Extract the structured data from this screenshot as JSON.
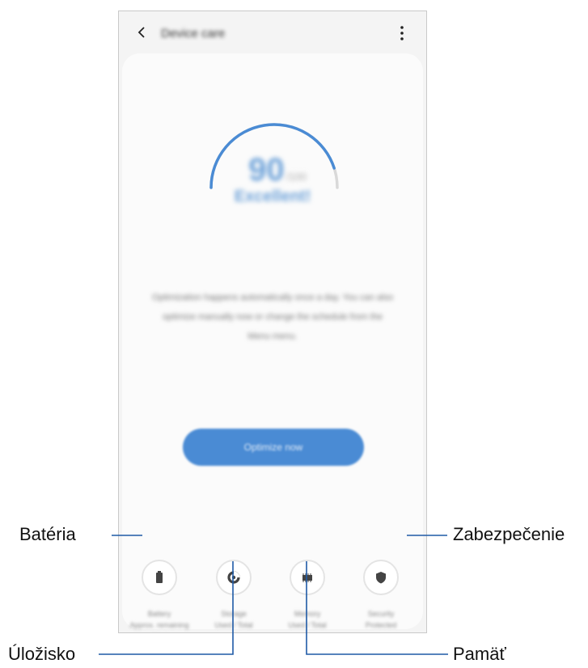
{
  "app_bar": {
    "title": "Device care",
    "back_icon": "chevron-left-icon",
    "menu_icon": "more-vertical-icon"
  },
  "score": {
    "value": "90",
    "unit": "/100",
    "status": "Excellent!",
    "level": 0.9,
    "accent_color": "#4a8bd4"
  },
  "description": "Optimization happens automatically once a day. You can also optimize manually now or change the schedule from the Menu menu.",
  "optimize_button": {
    "label": "Optimize now"
  },
  "categories": [
    {
      "icon": "battery-icon",
      "label": "Battery",
      "sub": "Approx. remaining time"
    },
    {
      "icon": "storage-pie-icon",
      "label": "Storage",
      "sub": "Used / Total"
    },
    {
      "icon": "memory-chip-icon",
      "label": "Memory",
      "sub": "Used / Total"
    },
    {
      "icon": "shield-icon",
      "label": "Security",
      "sub": "Protected"
    }
  ],
  "callouts": {
    "battery": "Batéria",
    "storage": "Úložisko",
    "memory": "Pamäť",
    "security": "Zabezpečenie"
  }
}
